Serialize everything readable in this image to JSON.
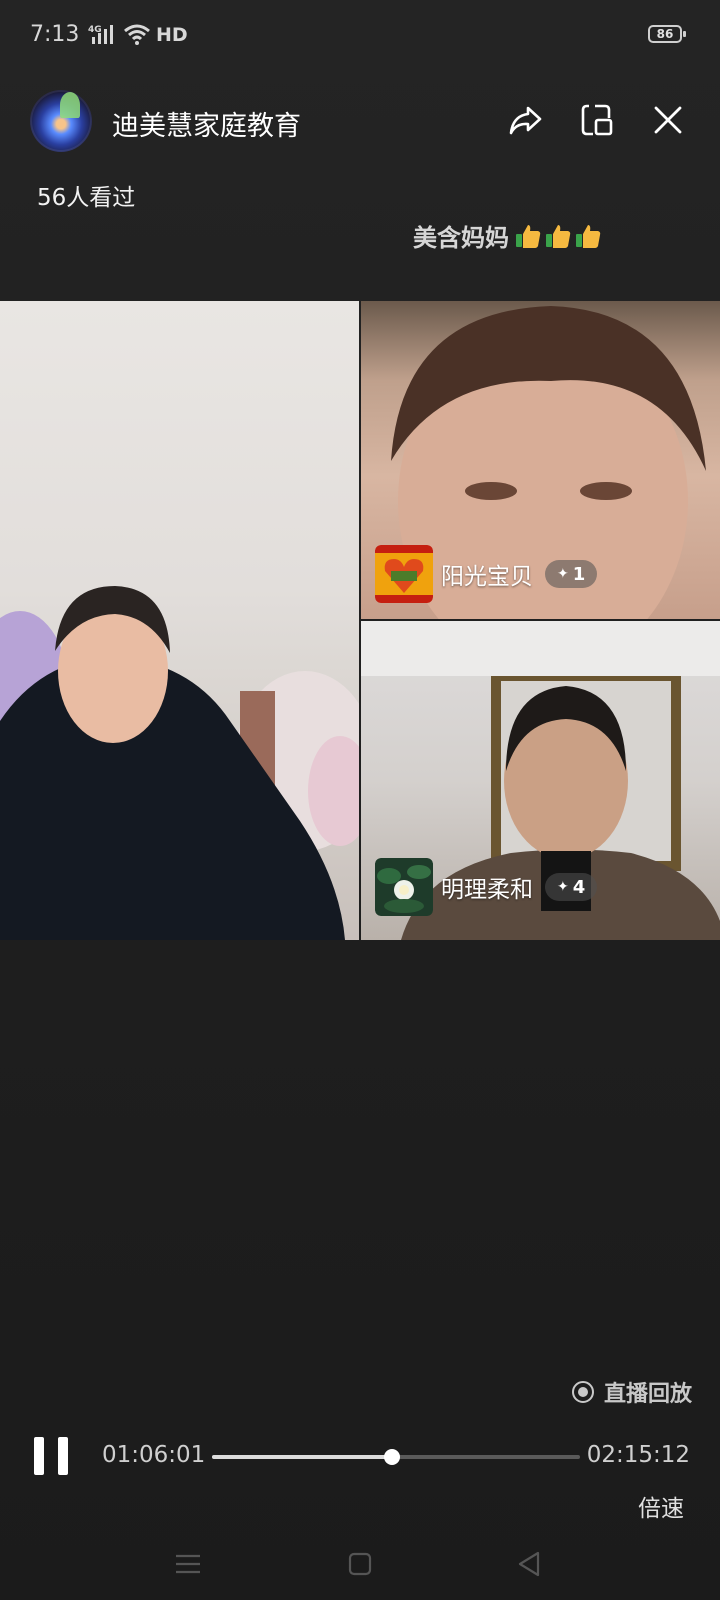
{
  "status_bar": {
    "time": "7:13",
    "network": "4G",
    "hd_label": "HD",
    "battery": "86"
  },
  "header": {
    "channel_name": "迪美慧家庭教育",
    "viewers": "56人看过",
    "icons": [
      "share-icon",
      "picture-in-picture-icon",
      "close-icon"
    ]
  },
  "comment": {
    "text": "美含妈妈",
    "emoji": [
      "thumbs-up",
      "thumbs-up",
      "thumbs-up"
    ]
  },
  "participants": [
    {
      "name": "阳光宝贝",
      "badge": "1"
    },
    {
      "name": "明理柔和",
      "badge": "4"
    }
  ],
  "player": {
    "replay_label": "直播回放",
    "current_time": "01:06:01",
    "total_time": "02:15:12",
    "progress": 0.49,
    "speed_label": "倍速"
  },
  "colors": {
    "background": "#1d1d1d",
    "text": "#ffffff",
    "progress_fill": "#dcdcdc",
    "progress_track": "#5a5a5a"
  }
}
